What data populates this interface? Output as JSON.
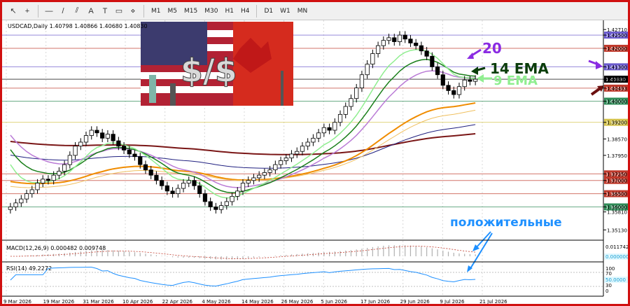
{
  "toolbar": {
    "items": [
      {
        "name": "cursor-icon",
        "glyph": "↖"
      },
      {
        "name": "crosshair-icon",
        "glyph": "+"
      },
      {
        "name": "horizontal-line-icon",
        "glyph": "—"
      },
      {
        "name": "trendline-icon",
        "glyph": "/"
      },
      {
        "name": "channel-icon",
        "glyph": "⫽"
      },
      {
        "name": "text-icon",
        "glyph": "A"
      },
      {
        "name": "label-icon",
        "glyph": "T"
      },
      {
        "name": "object-icon",
        "glyph": "▭"
      },
      {
        "name": "shapes-icon",
        "glyph": "⋄"
      }
    ],
    "timeframes": [
      "M1",
      "M5",
      "M15",
      "M30",
      "H1",
      "H4",
      "D1",
      "W1",
      "MN"
    ]
  },
  "symbol_header": "USDCAD,Daily  1.40798 1.40866 1.40680 1.40830",
  "chart_data": {
    "type": "candlestick",
    "symbol": "USDCAD",
    "timeframe": "Daily",
    "ohlc_last": {
      "open": 1.40798,
      "high": 1.40866,
      "low": 1.4068,
      "close": 1.4083
    },
    "ylim": [
      1.349,
      1.429
    ],
    "price_ticks": [
      "1.42710",
      "1.42500",
      "1.42000",
      "1.41300",
      "1.40830",
      "1.40493",
      "1.40000",
      "1.39200",
      "1.38570",
      "1.37950",
      "1.37250",
      "1.37000",
      "1.36500",
      "1.36000",
      "1.35810",
      "1.35130"
    ],
    "highlighted_levels": [
      {
        "value": 1.425,
        "color": "#6a5acd"
      },
      {
        "value": 1.42,
        "color": "#c0392b"
      },
      {
        "value": 1.413,
        "color": "#6a5acd"
      },
      {
        "value": 1.4083,
        "color": "#000000"
      },
      {
        "value": 1.40493,
        "color": "#c0392b"
      },
      {
        "value": 1.4,
        "color": "#2e8b57"
      },
      {
        "value": 1.392,
        "color": "#d4c24a"
      },
      {
        "value": 1.3725,
        "color": "#c0392b"
      },
      {
        "value": 1.37,
        "color": "#c0392b"
      },
      {
        "value": 1.365,
        "color": "#c0392b"
      },
      {
        "value": 1.36,
        "color": "#2e8b57"
      }
    ],
    "date_labels": [
      "9 Mar 2026",
      "19 Mar 2026",
      "31 Mar 2026",
      "10 Apr 2026",
      "22 Apr 2026",
      "4 May 2026",
      "14 May 2026",
      "26 May 2026",
      "5 Jun 2026",
      "17 Jun 2026",
      "29 Jun 2026",
      "9 Jul 2026",
      "21 Jul 2026"
    ],
    "closes": [
      1.36,
      1.3615,
      1.363,
      1.365,
      1.3665,
      1.369,
      1.3705,
      1.37,
      1.372,
      1.3735,
      1.376,
      1.3795,
      1.383,
      1.3845,
      1.387,
      1.389,
      1.388,
      1.386,
      1.3875,
      1.385,
      1.383,
      1.3815,
      1.38,
      1.379,
      1.376,
      1.374,
      1.372,
      1.37,
      1.368,
      1.366,
      1.365,
      1.367,
      1.369,
      1.37,
      1.368,
      1.365,
      1.362,
      1.36,
      1.359,
      1.3605,
      1.362,
      1.364,
      1.366,
      1.369,
      1.37,
      1.371,
      1.372,
      1.373,
      1.374,
      1.376,
      1.3775,
      1.3785,
      1.38,
      1.381,
      1.383,
      1.3845,
      1.386,
      1.388,
      1.39,
      1.389,
      1.392,
      1.395,
      1.398,
      1.401,
      1.405,
      1.41,
      1.414,
      1.418,
      1.421,
      1.423,
      1.424,
      1.4225,
      1.425,
      1.4235,
      1.422,
      1.421,
      1.419,
      1.417,
      1.413,
      1.41,
      1.406,
      1.404,
      1.4025,
      1.4055,
      1.408,
      1.4075,
      1.4083
    ],
    "ema_14_label": "14 EMA",
    "ema_9_label": "9 EMA",
    "ema_20_label": "20",
    "annotation_positive": "положительные",
    "macd": {
      "label": "MACD(12,26,9) 0.000482 0.009748",
      "ticks": [
        "0.011742",
        "0.000000"
      ]
    },
    "rsi": {
      "label": "RSI(14) 49.2272",
      "ticks": [
        "100",
        "70",
        "50.0000",
        "30",
        "0"
      ]
    }
  },
  "colors": {
    "ema9": "#90ee90",
    "ema14": "#1a7f1a",
    "ema20": "#ba7bd6",
    "ema50": "#f08c00",
    "ema100": "#f0c060",
    "ema200": "#7a1616",
    "sma": "#202080",
    "arrow_dark_red": "#6b0f0f",
    "arrow_purple": "#8a2be2",
    "annotation_blue": "#1e90ff"
  }
}
